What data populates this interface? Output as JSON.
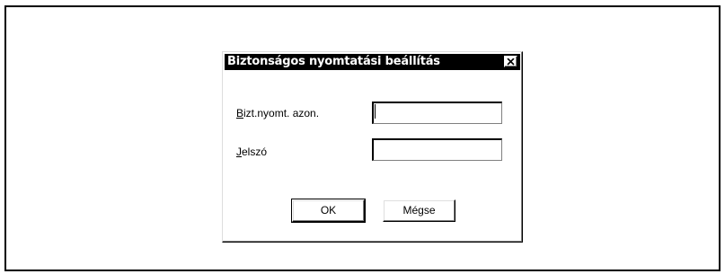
{
  "dialog": {
    "title": "Biztonságos nyomtatási beállítás",
    "fields": [
      {
        "label_accel": "B",
        "label_rest": "izt.nyomt. azon.",
        "value": ""
      },
      {
        "label_accel": "J",
        "label_rest": "elszó",
        "value": ""
      }
    ],
    "buttons": {
      "ok": "OK",
      "cancel": "Mégse"
    }
  },
  "icons": {
    "close": "close-icon"
  },
  "colors": {
    "titlebar": "#000000",
    "title_text": "#ffffff",
    "background": "#ffffff"
  }
}
